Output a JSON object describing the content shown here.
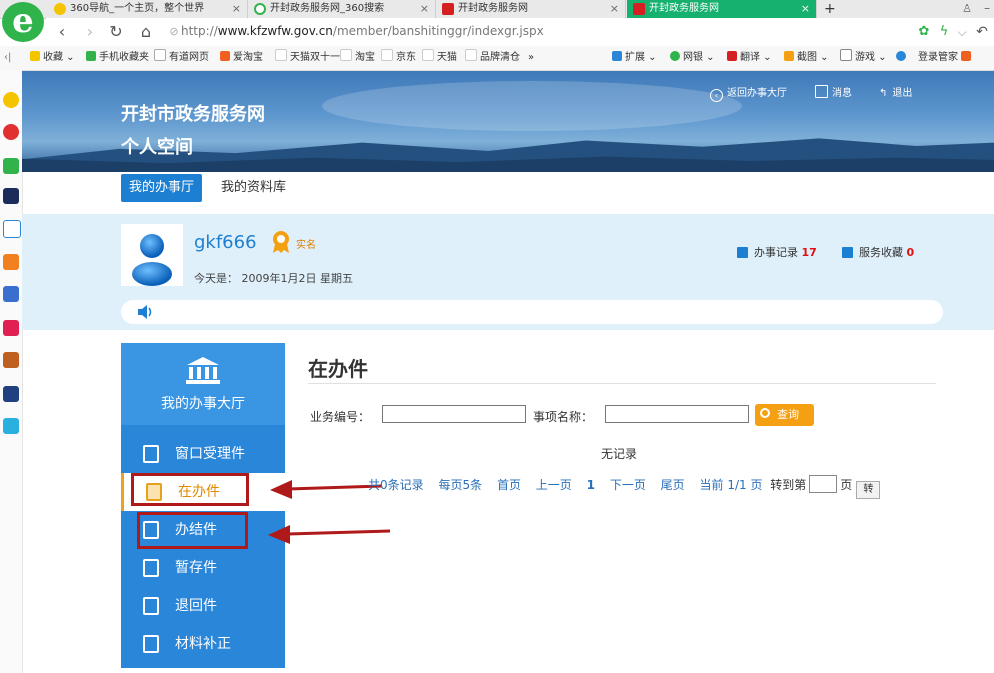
{
  "browser": {
    "tabs": [
      {
        "title": "360导航_一个主页，整个世界",
        "icon_color": "#f5c400"
      },
      {
        "title": "开封政务服务网_360搜索",
        "icon_color": "#2fb34a"
      },
      {
        "title": "开封政务服务网",
        "icon_color": "#d42020"
      },
      {
        "title": "开封政务服务网",
        "icon_color": "#d42020",
        "active": true
      }
    ],
    "new_tab": "+",
    "url_prefix": "http://",
    "url_host": "www.kfzwfw.gov.cn",
    "url_path": "/member/banshitinggr/indexgr.jspx",
    "bookmarks_left": [
      "收藏",
      "手机收藏夹",
      "有道网页",
      "爱淘宝",
      "天猫双十一",
      "淘宝",
      "京东",
      "天猫",
      "品牌清仓"
    ],
    "bookmarks_right": [
      "扩展",
      "网银",
      "翻译",
      "截图",
      "游戏",
      "登录管家"
    ],
    "more": "»"
  },
  "banner": {
    "title1": "开封市政务服务网",
    "title2": "个人空间",
    "links": [
      "返回办事大厅",
      "消息",
      "退出"
    ]
  },
  "nav": {
    "tab_mine": "我的办事厅",
    "tab_library": "我的资料库"
  },
  "user": {
    "name": "gkf666",
    "verified": "实名",
    "today_label": "今天是：",
    "today_value": "2009年1月2日 星期五",
    "records_label": "办事记录",
    "records_count": "17",
    "favorites_label": "服务收藏",
    "favorites_count": "0"
  },
  "sidebar": {
    "hall_label": "我的办事大厅",
    "items": [
      "窗口受理件",
      "在办件",
      "办结件",
      "暂存件",
      "退回件",
      "材料补正"
    ]
  },
  "main": {
    "title": "在办件",
    "field1_label": "业务编号：",
    "field1_value": "",
    "field2_label": "事项名称：",
    "field2_value": "",
    "search_label": "查询",
    "no_record": "无记录",
    "pager": {
      "total": "共0条记录",
      "per_page": "每页5条",
      "first": "首页",
      "prev": "上一页",
      "current_page": "1",
      "next": "下一页",
      "last": "尾页",
      "current": "当前 1/1 页",
      "goto_label": "转到第",
      "page_unit": "页",
      "go": "转"
    }
  },
  "colors": {
    "primary": "#1d7fd1",
    "sidebar": "#2a86d9",
    "accent": "#f5a013",
    "annotation_red": "#b01919"
  }
}
